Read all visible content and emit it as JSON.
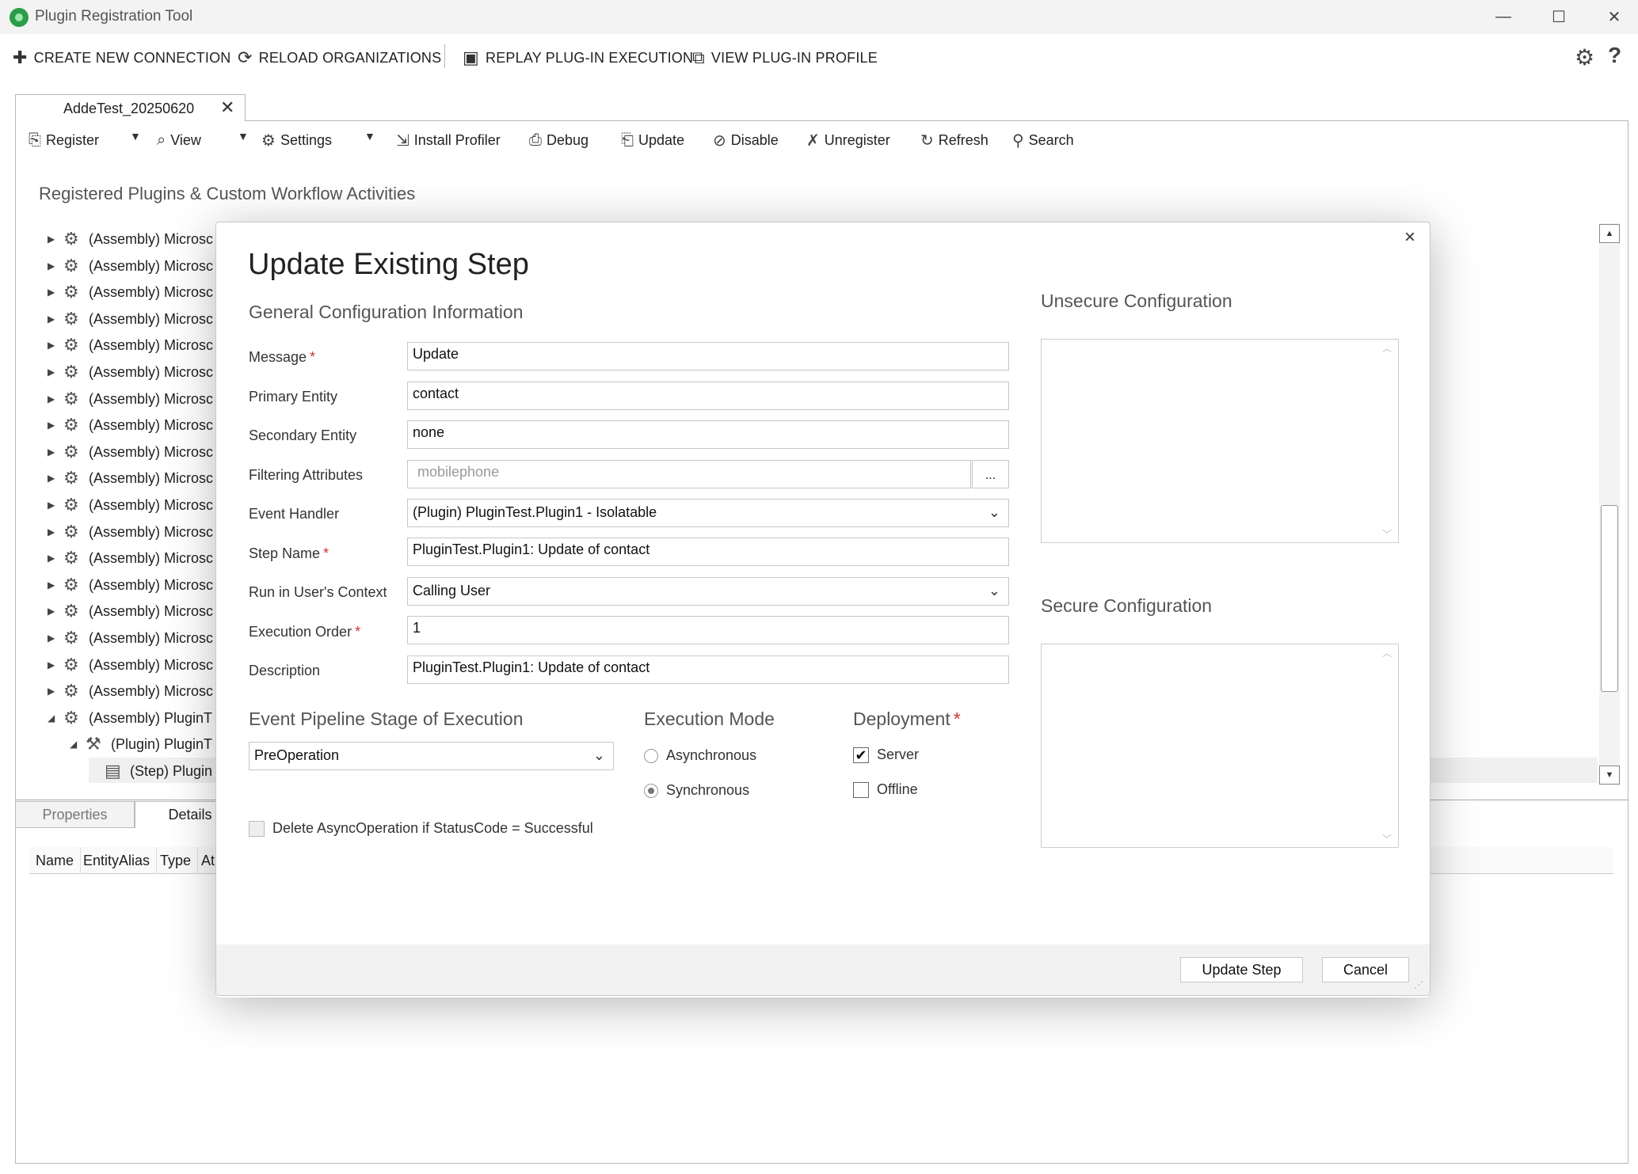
{
  "app": {
    "title": "Plugin Registration Tool",
    "window_controls": {
      "minimize": "—",
      "maximize": "☐",
      "close": "✕"
    }
  },
  "main_toolbar": {
    "create_connection": "CREATE NEW CONNECTION",
    "reload_orgs": "RELOAD ORGANIZATIONS",
    "replay": "REPLAY PLUG-IN EXECUTION",
    "view_profile": "VIEW PLUG-IN PROFILE",
    "help": "?"
  },
  "connection_tab": {
    "label": "AddeTest_20250620",
    "close": "✕"
  },
  "secondary_toolbar": {
    "register": "Register",
    "view": "View",
    "settings": "Settings",
    "install_profiler": "Install Profiler",
    "debug": "Debug",
    "update": "Update",
    "disable": "Disable",
    "unregister": "Unregister",
    "refresh": "Refresh",
    "search": "Search"
  },
  "tree": {
    "heading": "Registered Plugins & Custom Workflow Activities",
    "items": [
      "(Assembly) Microsc",
      "(Assembly) Microsc",
      "(Assembly) Microsc",
      "(Assembly) Microsc",
      "(Assembly) Microsc",
      "(Assembly) Microsc",
      "(Assembly) Microsc",
      "(Assembly) Microsc",
      "(Assembly) Microsc",
      "(Assembly) Microsc",
      "(Assembly) Microsc",
      "(Assembly) Microsc",
      "(Assembly) Microsc",
      "(Assembly) Microsc",
      "(Assembly) Microsc",
      "(Assembly) Microsc",
      "(Assembly) Microsc",
      "(Assembly) Microsc"
    ],
    "expanded_assembly": "(Assembly) PluginT",
    "plugin_node": "(Plugin) PluginT",
    "step_node": "(Step) Plugin"
  },
  "bottom_pane": {
    "tabs": {
      "properties": "Properties",
      "details": "Details"
    },
    "columns": [
      "Name",
      "EntityAlias",
      "Type",
      "At"
    ]
  },
  "modal": {
    "close": "×",
    "title": "Update Existing Step",
    "general_heading": "General Configuration Information",
    "fields": {
      "message": {
        "label": "Message",
        "value": "Update"
      },
      "primary_entity": {
        "label": "Primary Entity",
        "value": "contact"
      },
      "secondary_entity": {
        "label": "Secondary Entity",
        "value": "none"
      },
      "filtering_attributes": {
        "label": "Filtering Attributes",
        "value": "mobilephone",
        "button": "..."
      },
      "event_handler": {
        "label": "Event Handler",
        "value": "(Plugin) PluginTest.Plugin1 - Isolatable"
      },
      "step_name": {
        "label": "Step Name",
        "value": "PluginTest.Plugin1: Update of contact"
      },
      "run_context": {
        "label": "Run in User's Context",
        "value": "Calling User"
      },
      "execution_order": {
        "label": "Execution Order",
        "value": "1"
      },
      "description": {
        "label": "Description",
        "value": "PluginTest.Plugin1: Update of contact"
      }
    },
    "required_mark": "*",
    "pipeline": {
      "heading": "Event Pipeline Stage of Execution",
      "value": "PreOperation"
    },
    "execution_mode": {
      "heading": "Execution Mode",
      "asynchronous": "Asynchronous",
      "synchronous": "Synchronous",
      "selected": "Synchronous"
    },
    "deployment": {
      "heading": "Deployment",
      "server": "Server",
      "offline": "Offline",
      "server_checked": true,
      "offline_checked": false
    },
    "delete_async": {
      "label": "Delete AsyncOperation if StatusCode = Successful",
      "checked": false
    },
    "unsecure_heading": "Unsecure  Configuration",
    "secure_heading": "Secure  Configuration",
    "buttons": {
      "update": "Update Step",
      "cancel": "Cancel"
    }
  },
  "colors": {
    "required": "#d13438",
    "app_icon": "#2a9d4a"
  }
}
